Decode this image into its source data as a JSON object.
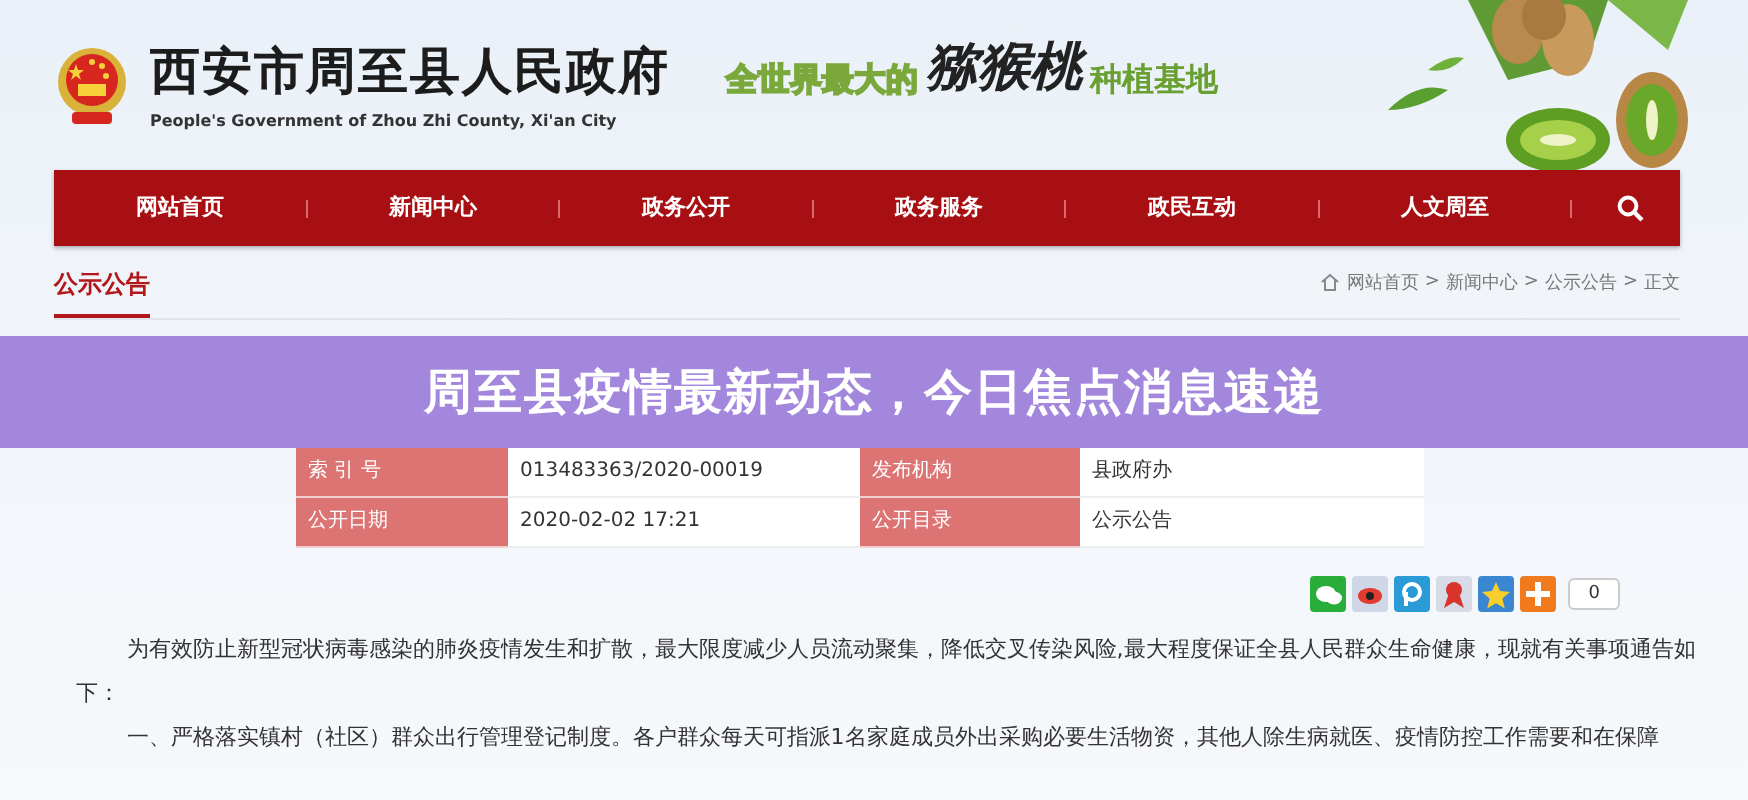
{
  "header": {
    "title": "西安市周至县人民政府",
    "subtitle": "People's Government of Zhou Zhi County, Xi'an City",
    "slogan": {
      "lead": "全世界最大的",
      "highlight": "猕猴桃",
      "tail": "种植基地"
    }
  },
  "nav": {
    "items": [
      {
        "label": "网站首页",
        "selected": false
      },
      {
        "label": "新闻中心",
        "selected": false
      },
      {
        "label": "政务公开",
        "selected": false
      },
      {
        "label": "政务服务",
        "selected": false
      },
      {
        "label": "政民互动",
        "selected": false
      },
      {
        "label": "人文周至",
        "selected": false
      }
    ]
  },
  "section": {
    "title": "公示公告",
    "breadcrumb": [
      "网站首页",
      "新闻中心",
      "公示公告",
      "正文"
    ],
    "separator": ">"
  },
  "banner": {
    "text": "周至县疫情最新动态，今日焦点消息速递"
  },
  "info_table": {
    "rows": [
      {
        "label_1": "索 引 号",
        "value_1": "013483363/2020-00019",
        "label_2": "发布机构",
        "value_2": "县政府办"
      },
      {
        "label_1": "公开日期",
        "value_1": "2020-02-02 17:21",
        "label_2": "公开目录",
        "value_2": "公示公告"
      }
    ]
  },
  "share": {
    "count": "0"
  },
  "article": {
    "paragraphs": [
      {
        "text": "为有效防止新型冠状病毒感染的肺炎疫情发生和扩散，最大限度减少人员流动聚集，降低交叉传染风险,最大程度保证全县人民群众生命健康，现就有关事项通告如下：",
        "kind": "wrap"
      },
      {
        "text": "一、严格落实镇村（社区）群众出行管理登记制度。各户群众每天可指派1名家庭成员外出采购必要生活物资，其他人除生病就医、疫情防控工作需要和在保障",
        "kind": "cut"
      }
    ]
  }
}
